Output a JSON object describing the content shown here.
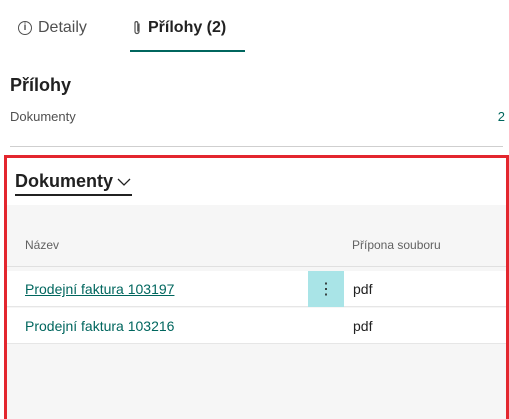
{
  "tabs": [
    {
      "label": "Detaily",
      "icon": "info-icon"
    },
    {
      "label": "Přílohy (2)",
      "icon": "paperclip-icon"
    }
  ],
  "factbox": {
    "title": "Přílohy",
    "row_label": "Dokumenty",
    "row_value": "2"
  },
  "documents": {
    "title": "Dokumenty",
    "columns": {
      "name": "Název",
      "extension": "Přípona souboru"
    },
    "rows": [
      {
        "name": "Prodejní faktura 103197",
        "extension": "pdf"
      },
      {
        "name": "Prodejní faktura 103216",
        "extension": "pdf"
      }
    ],
    "row_menu_glyph": "⋮"
  },
  "colors": {
    "accent": "#00665e",
    "highlight_frame": "#e3262e",
    "row_menu_bg": "#a9e4e7"
  }
}
